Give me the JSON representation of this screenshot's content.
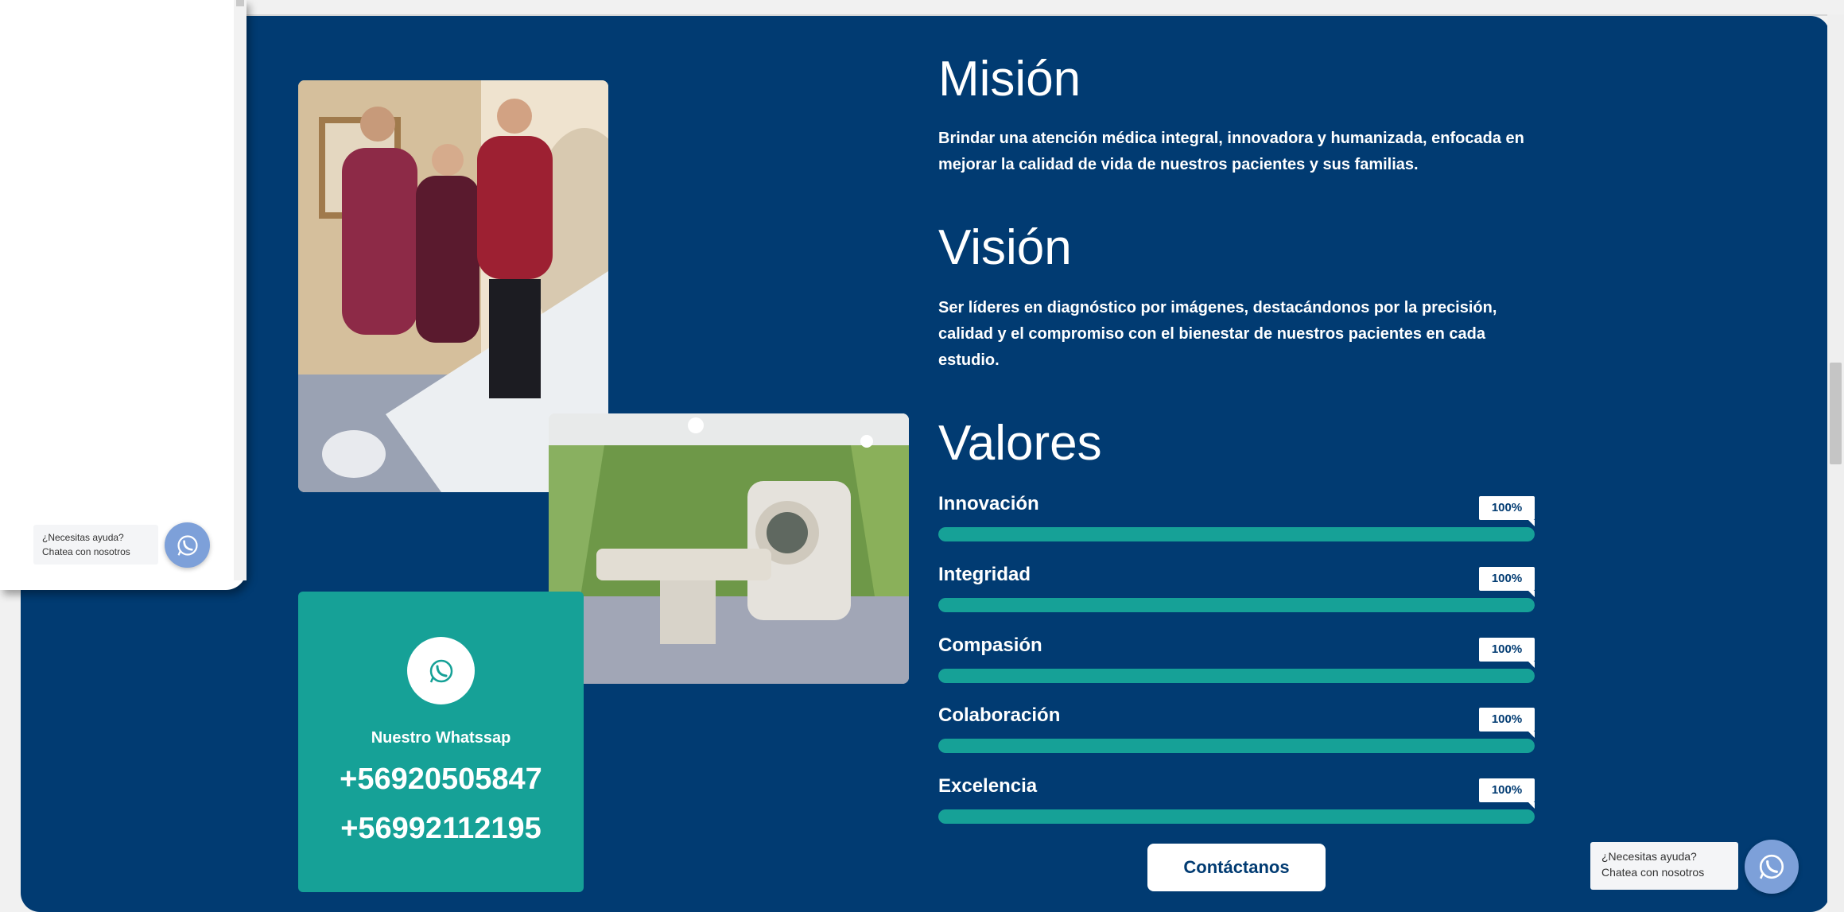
{
  "mission": {
    "title": "Misión",
    "text": "Brindar una atención médica integral, innovadora y humanizada, enfocada en mejorar la calidad de vida de nuestros pacientes y sus familias."
  },
  "vision": {
    "title": "Visión",
    "text": "Ser líderes en diagnóstico por imágenes, destacándonos por la precisión, calidad y el compromiso con el bienestar de nuestros pacientes en cada estudio."
  },
  "values": {
    "title": "Valores",
    "items": [
      {
        "label": "Innovación",
        "percent_label": "100%",
        "percent": 100
      },
      {
        "label": "Integridad",
        "percent_label": "100%",
        "percent": 100
      },
      {
        "label": "Compasión",
        "percent_label": "100%",
        "percent": 100
      },
      {
        "label": "Colaboración",
        "percent_label": "100%",
        "percent": 100
      },
      {
        "label": "Excelencia",
        "percent_label": "100%",
        "percent": 100
      }
    ]
  },
  "contact_button": "Contáctanos",
  "whatsapp_card": {
    "label": "Nuestro Whatssap",
    "phones": [
      "+56920505847",
      "+56992112195"
    ]
  },
  "chat_widget": {
    "line1": "¿Necesitas ayuda?",
    "line2": "Chatea con nosotros"
  },
  "colors": {
    "section_bg": "#013b72",
    "accent": "#16a197",
    "widget_button": "#7da0d9"
  },
  "images": {
    "team_photo": "staff-in-scanner-room",
    "scanner_photo": "ct-scanner-room"
  }
}
